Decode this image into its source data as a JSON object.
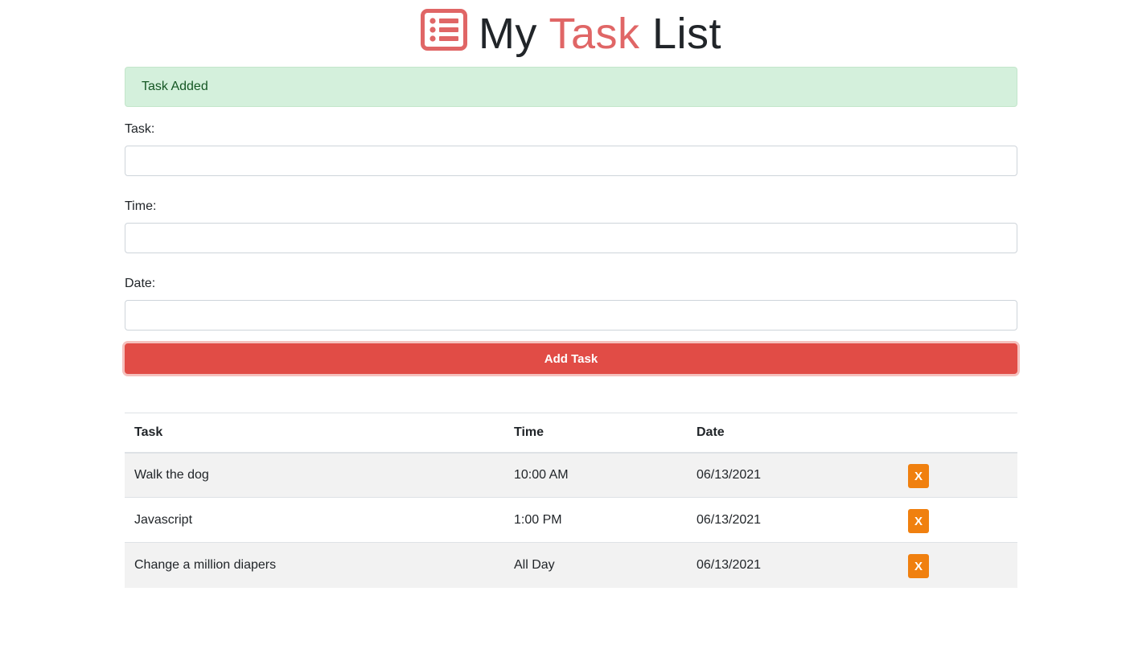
{
  "header": {
    "title_part1": "My",
    "title_accent": "Task",
    "title_part2": "List",
    "logo_icon": "list-alt-icon",
    "accent_color": "#e06666"
  },
  "alert": {
    "message": "Task Added",
    "type": "success"
  },
  "form": {
    "task": {
      "label": "Task:",
      "value": "",
      "placeholder": ""
    },
    "time": {
      "label": "Time:",
      "value": "",
      "placeholder": ""
    },
    "date": {
      "label": "Date:",
      "value": "",
      "placeholder": ""
    },
    "submit_label": "Add Task",
    "submit_color": "#e14c46"
  },
  "table": {
    "headers": [
      "Task",
      "Time",
      "Date",
      ""
    ],
    "rows": [
      {
        "task": "Walk the dog",
        "time": "10:00 AM",
        "date": "06/13/2021",
        "delete_label": "X"
      },
      {
        "task": "Javascript",
        "time": "1:00 PM",
        "date": "06/13/2021",
        "delete_label": "X"
      },
      {
        "task": "Change a million diapers",
        "time": "All Day",
        "date": "06/13/2021",
        "delete_label": "X"
      }
    ],
    "delete_color": "#f0800f"
  }
}
